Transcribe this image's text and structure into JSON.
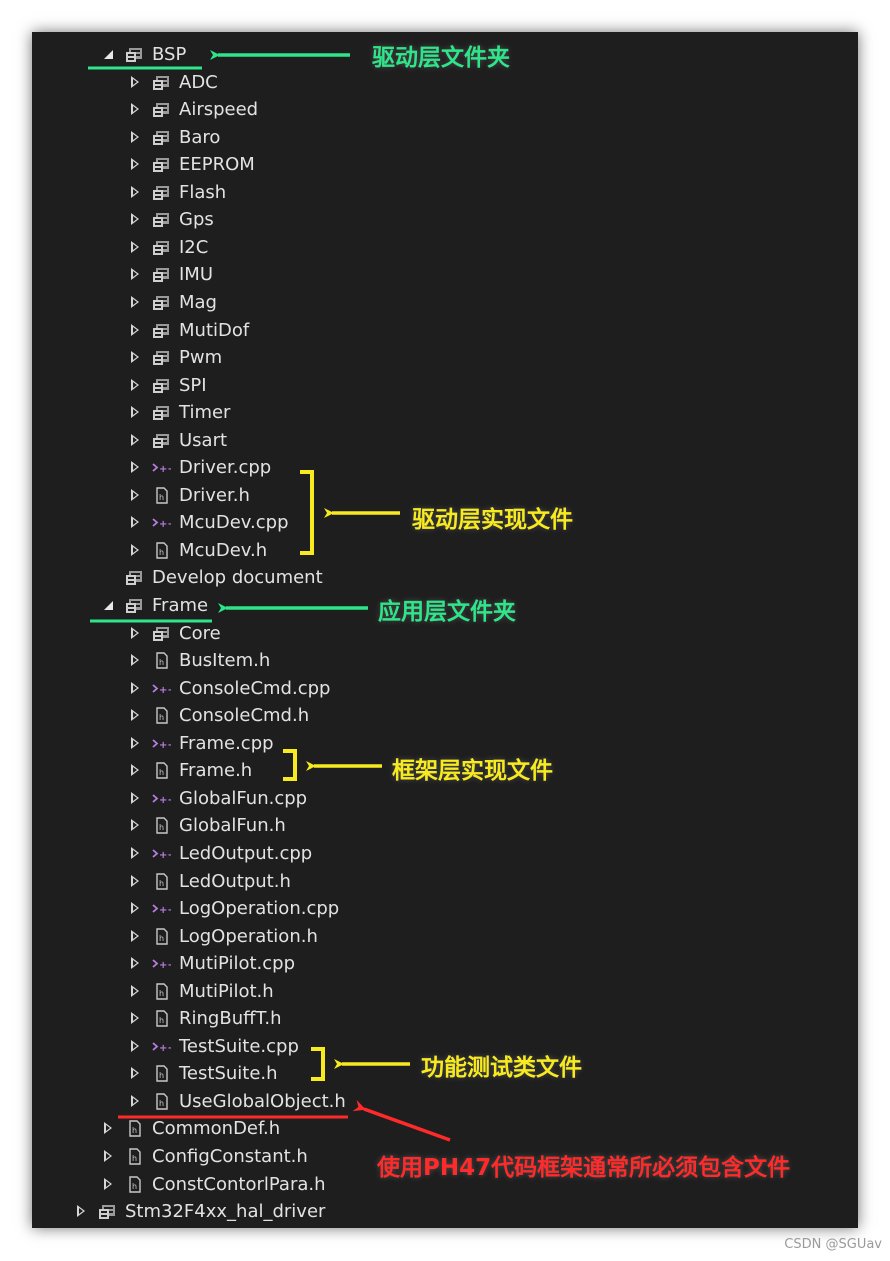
{
  "tree": [
    {
      "label": "BSP",
      "depth": 1,
      "type": "folder",
      "state": "expanded"
    },
    {
      "label": "ADC",
      "depth": 2,
      "type": "folder",
      "state": "collapsed"
    },
    {
      "label": "Airspeed",
      "depth": 2,
      "type": "folder",
      "state": "collapsed"
    },
    {
      "label": "Baro",
      "depth": 2,
      "type": "folder",
      "state": "collapsed"
    },
    {
      "label": "EEPROM",
      "depth": 2,
      "type": "folder",
      "state": "collapsed"
    },
    {
      "label": "Flash",
      "depth": 2,
      "type": "folder",
      "state": "collapsed"
    },
    {
      "label": "Gps",
      "depth": 2,
      "type": "folder",
      "state": "collapsed"
    },
    {
      "label": "I2C",
      "depth": 2,
      "type": "folder",
      "state": "collapsed"
    },
    {
      "label": "IMU",
      "depth": 2,
      "type": "folder",
      "state": "collapsed"
    },
    {
      "label": "Mag",
      "depth": 2,
      "type": "folder",
      "state": "collapsed"
    },
    {
      "label": "MutiDof",
      "depth": 2,
      "type": "folder",
      "state": "collapsed"
    },
    {
      "label": "Pwm",
      "depth": 2,
      "type": "folder",
      "state": "collapsed"
    },
    {
      "label": "SPI",
      "depth": 2,
      "type": "folder",
      "state": "collapsed"
    },
    {
      "label": "Timer",
      "depth": 2,
      "type": "folder",
      "state": "collapsed"
    },
    {
      "label": "Usart",
      "depth": 2,
      "type": "folder",
      "state": "collapsed"
    },
    {
      "label": "Driver.cpp",
      "depth": 2,
      "type": "cpp",
      "state": "collapsed"
    },
    {
      "label": "Driver.h",
      "depth": 2,
      "type": "h",
      "state": "collapsed"
    },
    {
      "label": "McuDev.cpp",
      "depth": 2,
      "type": "cpp",
      "state": "collapsed"
    },
    {
      "label": "McuDev.h",
      "depth": 2,
      "type": "h",
      "state": "collapsed"
    },
    {
      "label": "Develop document",
      "depth": 1,
      "type": "folder",
      "state": "none"
    },
    {
      "label": "Frame",
      "depth": 1,
      "type": "folder",
      "state": "expanded"
    },
    {
      "label": "Core",
      "depth": 2,
      "type": "folder",
      "state": "collapsed"
    },
    {
      "label": "BusItem.h",
      "depth": 2,
      "type": "h",
      "state": "collapsed"
    },
    {
      "label": "ConsoleCmd.cpp",
      "depth": 2,
      "type": "cpp",
      "state": "collapsed"
    },
    {
      "label": "ConsoleCmd.h",
      "depth": 2,
      "type": "h",
      "state": "collapsed"
    },
    {
      "label": "Frame.cpp",
      "depth": 2,
      "type": "cpp",
      "state": "collapsed"
    },
    {
      "label": "Frame.h",
      "depth": 2,
      "type": "h",
      "state": "collapsed"
    },
    {
      "label": "GlobalFun.cpp",
      "depth": 2,
      "type": "cpp",
      "state": "collapsed"
    },
    {
      "label": "GlobalFun.h",
      "depth": 2,
      "type": "h",
      "state": "collapsed"
    },
    {
      "label": "LedOutput.cpp",
      "depth": 2,
      "type": "cpp",
      "state": "collapsed"
    },
    {
      "label": "LedOutput.h",
      "depth": 2,
      "type": "h",
      "state": "collapsed"
    },
    {
      "label": "LogOperation.cpp",
      "depth": 2,
      "type": "cpp",
      "state": "collapsed"
    },
    {
      "label": "LogOperation.h",
      "depth": 2,
      "type": "h",
      "state": "collapsed"
    },
    {
      "label": "MutiPilot.cpp",
      "depth": 2,
      "type": "cpp",
      "state": "collapsed"
    },
    {
      "label": "MutiPilot.h",
      "depth": 2,
      "type": "h",
      "state": "collapsed"
    },
    {
      "label": "RingBuffT.h",
      "depth": 2,
      "type": "h",
      "state": "collapsed"
    },
    {
      "label": "TestSuite.cpp",
      "depth": 2,
      "type": "cpp",
      "state": "collapsed"
    },
    {
      "label": "TestSuite.h",
      "depth": 2,
      "type": "h",
      "state": "collapsed"
    },
    {
      "label": "UseGlobalObject.h",
      "depth": 2,
      "type": "h",
      "state": "collapsed"
    },
    {
      "label": "CommonDef.h",
      "depth": 1,
      "type": "h",
      "state": "collapsed"
    },
    {
      "label": "ConfigConstant.h",
      "depth": 1,
      "type": "h",
      "state": "collapsed"
    },
    {
      "label": "ConstContorlPara.h",
      "depth": 1,
      "type": "h",
      "state": "collapsed"
    },
    {
      "label": "Stm32F4xx_hal_driver",
      "depth": 0,
      "type": "folder",
      "state": "collapsed"
    }
  ],
  "annotations": {
    "bsp_folder": "驱动层文件夹",
    "driver_impl": "驱动层实现文件",
    "app_folder": "应用层文件夹",
    "frame_impl": "框架层实现文件",
    "test_files": "功能测试类文件",
    "required_include": "使用PH47代码框架通常所必须包含文件"
  },
  "colors": {
    "panel_bg": "#1e1e1e",
    "text": "#e2e2e2",
    "annotation_green": "#2ee58a",
    "annotation_yellow": "#f7ea1e",
    "annotation_red": "#ff2a2a",
    "cpp_icon": "#b77de0",
    "h_icon": "#c8c8c8"
  },
  "icons": {
    "folder": "solution-folder-icon",
    "cpp": "cpp-file-icon",
    "h": "header-file-icon"
  },
  "watermark": "CSDN @SGUav"
}
